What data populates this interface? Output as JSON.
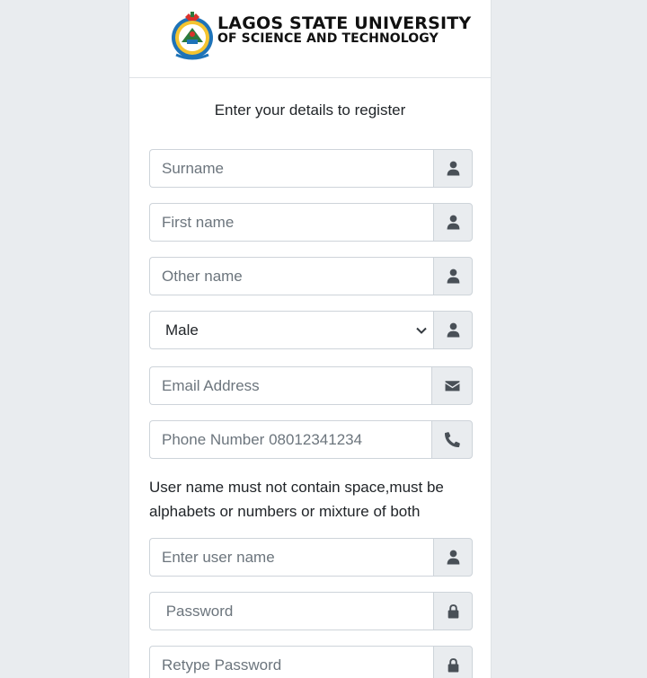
{
  "header": {
    "title_line1": "LAGOS STATE UNIVERSITY",
    "title_line2": "OF SCIENCE AND TECHNOLOGY"
  },
  "form": {
    "intro": "Enter your details to register",
    "surname_placeholder": "Surname",
    "firstname_placeholder": "First name",
    "othername_placeholder": "Other name",
    "gender_selected": "Male",
    "email_placeholder": "Email Address",
    "phone_placeholder": "Phone Number 08012341234",
    "username_note": "User name must not contain space,must be alphabets or numbers or mixture of both",
    "username_placeholder": "Enter user name",
    "password_placeholder": " Password",
    "retype_password_placeholder": "Retype Password"
  },
  "icons": {
    "person": "user-icon",
    "mail": "envelope-icon",
    "phone": "phone-icon",
    "lock": "lock-icon"
  },
  "colors": {
    "addon_bg": "#e9ecef",
    "border": "#ced4da",
    "page_bg": "#e9ecef"
  }
}
